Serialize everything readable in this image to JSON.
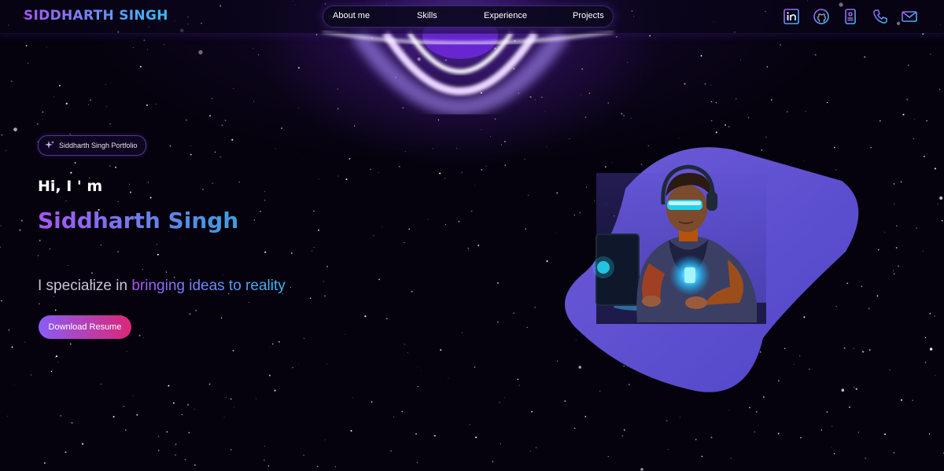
{
  "header": {
    "brand": "SIDDHARTH SINGH",
    "nav": [
      {
        "label": "About me"
      },
      {
        "label": "Skills"
      },
      {
        "label": "Experience"
      },
      {
        "label": "Projects"
      }
    ],
    "social_icons": [
      "linkedin-icon",
      "github-icon",
      "resume-card-icon",
      "phone-icon",
      "email-icon"
    ]
  },
  "hero": {
    "badge": {
      "icon": "sparkle-icon",
      "text": "Siddharth Singh Portfolio"
    },
    "greeting": "Hi, I ' m",
    "name": "Siddharth Singh",
    "tagline_prefix": "I specialize in ",
    "tagline_highlight": "bringing ideas to reality",
    "resume_button": "Download Resume",
    "illustration": "developer-with-laptop-illustration"
  },
  "colors": {
    "background": "#05020d",
    "accent_purple": "#a855f7",
    "accent_blue": "#38bdf8",
    "button_start": "#8b5cf6",
    "button_end": "#db2777",
    "blob": "#5b4fd0"
  }
}
